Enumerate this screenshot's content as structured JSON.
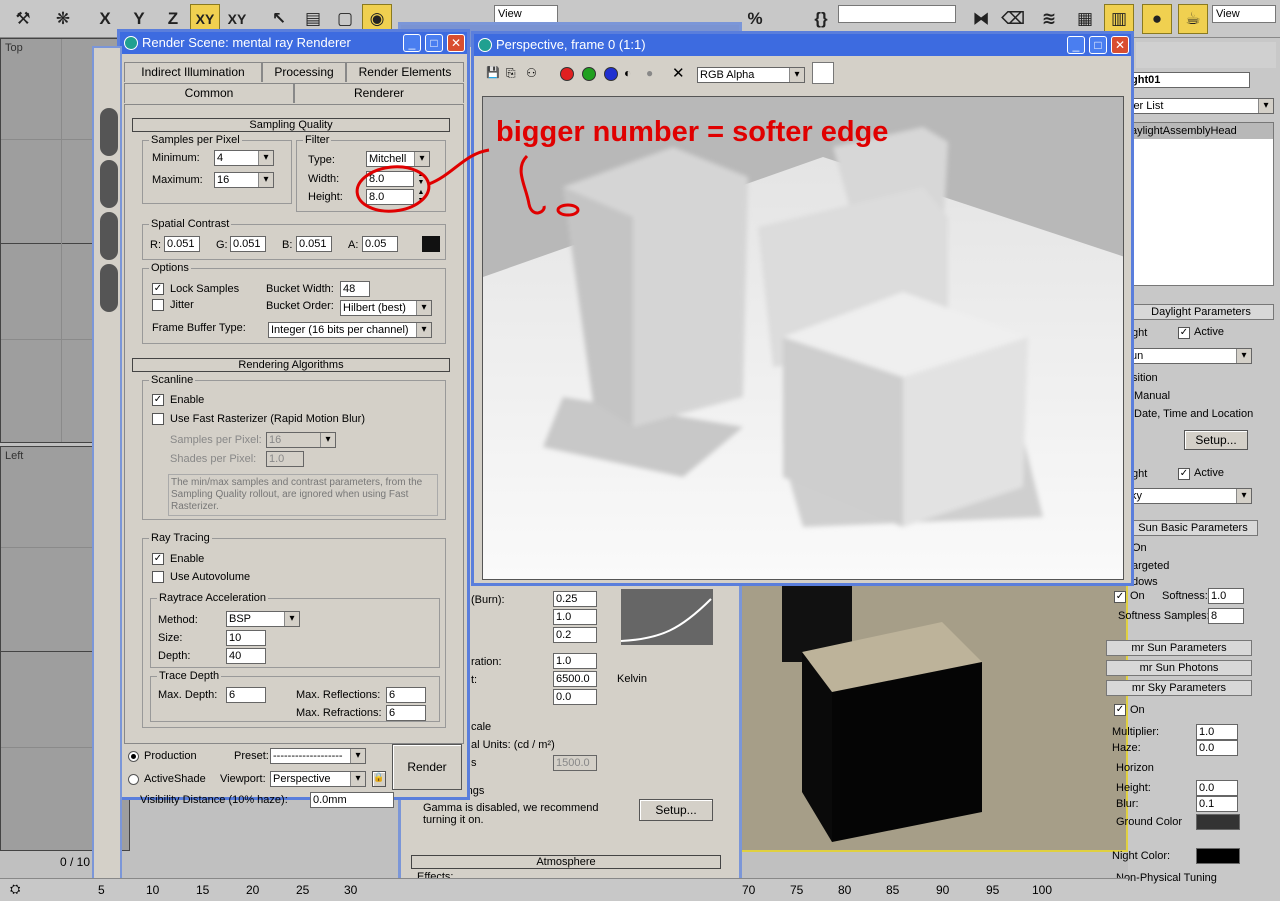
{
  "main_toolbar": {
    "axis_buttons": [
      "X",
      "Y",
      "Z",
      "XY",
      "XY"
    ],
    "view_dropdown": "View",
    "right_view_dropdown": "View"
  },
  "viewports": {
    "top_label": "Top",
    "left_label": "Left"
  },
  "render_scene": {
    "title": "Render Scene: mental ray Renderer",
    "tabs_row1": [
      "Indirect Illumination",
      "Processing",
      "Render Elements"
    ],
    "tabs_row2": [
      "Common",
      "Renderer"
    ],
    "sampling_quality": {
      "rollout": "Sampling Quality",
      "samples_group": "Samples per Pixel",
      "minimum_label": "Minimum:",
      "minimum_value": "4",
      "maximum_label": "Maximum:",
      "maximum_value": "16",
      "filter_group": "Filter",
      "type_label": "Type:",
      "type_value": "Mitchell",
      "width_label": "Width:",
      "width_value": "8.0",
      "height_label": "Height:",
      "height_value": "8.0",
      "spatial_group": "Spatial Contrast",
      "r_label": "R:",
      "r_value": "0.051",
      "g_label": "G:",
      "g_value": "0.051",
      "b_label": "B:",
      "b_value": "0.051",
      "a_label": "A:",
      "a_value": "0.05",
      "options_group": "Options",
      "lock_samples": "Lock Samples",
      "jitter": "Jitter",
      "bucket_width_label": "Bucket Width:",
      "bucket_width_value": "48",
      "bucket_order_label": "Bucket Order:",
      "bucket_order_value": "Hilbert (best)",
      "frame_buffer_label": "Frame Buffer Type:",
      "frame_buffer_value": "Integer (16 bits per channel)"
    },
    "rendering_algorithms": {
      "rollout": "Rendering Algorithms",
      "scanline_group": "Scanline",
      "enable": "Enable",
      "fast_rasterizer": "Use Fast Rasterizer (Rapid Motion Blur)",
      "samples_per_pixel_label": "Samples per Pixel:",
      "samples_per_pixel_value": "16",
      "shades_per_pixel_label": "Shades per Pixel:",
      "shades_per_pixel_value": "1.0",
      "note": "The min/max samples and contrast parameters, from the Sampling Quality rollout, are ignored when using Fast Rasterizer.",
      "raytracing_group": "Ray Tracing",
      "rt_enable": "Enable",
      "autovolume": "Use Autovolume",
      "accel_group": "Raytrace Acceleration",
      "method_label": "Method:",
      "method_value": "BSP",
      "size_label": "Size:",
      "size_value": "10",
      "depth_label": "Depth:",
      "depth_value": "40",
      "trace_group": "Trace Depth",
      "max_depth_label": "Max. Depth:",
      "max_depth_value": "6",
      "max_refl_label": "Max. Reflections:",
      "max_refl_value": "6",
      "max_refr_label": "Max. Refractions:",
      "max_refr_value": "6"
    },
    "footer": {
      "production": "Production",
      "activeshade": "ActiveShade",
      "preset_label": "Preset:",
      "preset_value": "-------------------",
      "viewport_label": "Viewport:",
      "viewport_value": "Perspective",
      "render_button": "Render"
    },
    "below": {
      "visibility": "Visibility Distance (10% haze):",
      "visibility_value": "0.0mm"
    }
  },
  "frame_window": {
    "title": "Perspective, frame 0 (1:1)",
    "channel_dropdown": "RGB Alpha",
    "annotation": "bigger number = softer edge"
  },
  "exposure_panel": {
    "burn_label": "(Burn):",
    "burn_value": "0.25",
    "v2": "1.0",
    "v3": "0.2",
    "saturation_label": "ration:",
    "saturation_value": "1.0",
    "whitepoint_label": "t:",
    "whitepoint_value": "6500.0",
    "kelvin": "Kelvin",
    "v6": "0.0",
    "scale_label": "cale",
    "units_label": "al Units: (cd / m²)",
    "s_label": "s",
    "units_value": "1500.0",
    "lut_label": "LUT Settings",
    "gamma_text": "Gamma is disabled, we recommend turning it on.",
    "setup_button": "Setup...",
    "atmosphere": "Atmosphere",
    "effects": "Effects:"
  },
  "command_panel": {
    "name_field": "ght01",
    "modifier_list": "ier List",
    "stack_item": "aylightAssemblyHead",
    "daylight_params": "Daylight Parameters",
    "sunlight_label": "ght",
    "active1": "Active",
    "sun_dropdown": "un",
    "position_label": "sition",
    "manual": "Manual",
    "date_time": "Date, Time and Location",
    "setup_button": "Setup...",
    "skylight_label": "ght",
    "active2": "Active",
    "sky_dropdown": "ky",
    "sun_basic": "Sun Basic Parameters",
    "on1": "On",
    "targeted": "argeted",
    "shadows": "dows",
    "on2": "On",
    "softness_label": "Softness:",
    "softness_value": "1.0",
    "soft_samples_label": "Softness Samples:",
    "soft_samples_value": "8",
    "mr_sun_params": "mr Sun Parameters",
    "mr_sun_photons": "mr Sun Photons",
    "mr_sky_params": "mr Sky Parameters",
    "on3": "On",
    "multiplier_label": "Multiplier:",
    "multiplier_value": "1.0",
    "haze_label": "Haze:",
    "haze_value": "0.0",
    "horizon": "Horizon",
    "hheight_label": "Height:",
    "hheight_value": "0.0",
    "blur_label": "Blur:",
    "blur_value": "0.1",
    "ground_color": "Ground Color",
    "night_color": "Night Color:",
    "non_physical": "Non-Physical Tuning"
  },
  "timeline": {
    "frame_counter": "0 / 10",
    "ticks_left": [
      "5",
      "10",
      "15",
      "20",
      "25",
      "30"
    ],
    "ticks_right": [
      "70",
      "75",
      "80",
      "85",
      "90",
      "95",
      "100"
    ]
  }
}
